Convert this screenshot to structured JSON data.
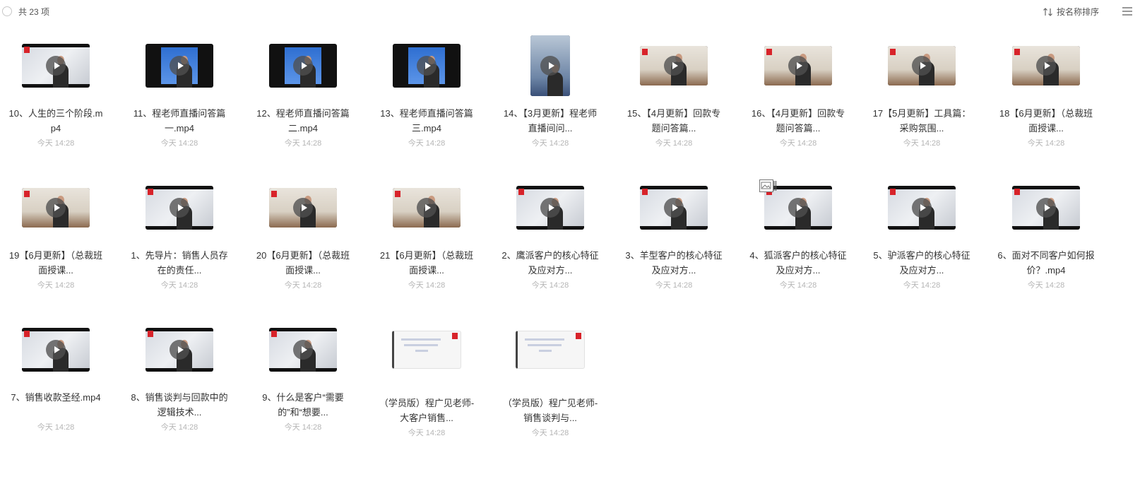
{
  "toolbar": {
    "count_label": "共 23 项",
    "sort_label": "按名称排序",
    "icons": [
      "sort-icon",
      "list-view-icon"
    ]
  },
  "files": [
    {
      "name": "10、人生的三个阶段.mp4",
      "time": "今天 14:28",
      "type": "video"
    },
    {
      "name": "11、程老师直播问答篇一.mp4",
      "time": "今天 14:28",
      "type": "video"
    },
    {
      "name": "12、程老师直播问答篇二.mp4",
      "time": "今天 14:28",
      "type": "video"
    },
    {
      "name": "13、程老师直播问答篇三.mp4",
      "time": "今天 14:28",
      "type": "video"
    },
    {
      "name": "14、【3月更新】程老师直播间问...",
      "time": "今天 14:28",
      "type": "video"
    },
    {
      "name": "15、【4月更新】回款专题问答篇...",
      "time": "今天 14:28",
      "type": "video"
    },
    {
      "name": "16、【4月更新】回款专题问答篇...",
      "time": "今天 14:28",
      "type": "video"
    },
    {
      "name": "17【5月更新】工具篇：采购氛围...",
      "time": "今天 14:28",
      "type": "video"
    },
    {
      "name": "18【6月更新】（总裁班面授课...",
      "time": "今天 14:28",
      "type": "video"
    },
    {
      "name": "19【6月更新】（总裁班面授课...",
      "time": "今天 14:28",
      "type": "video"
    },
    {
      "name": "1、先导片：销售人员存在的责任...",
      "time": "今天 14:28",
      "type": "video"
    },
    {
      "name": "20【6月更新】（总裁班面授课...",
      "time": "今天 14:28",
      "type": "video"
    },
    {
      "name": "21【6月更新】（总裁班面授课...",
      "time": "今天 14:28",
      "type": "video"
    },
    {
      "name": "2、鹰派客户的核心特征及应对方...",
      "time": "今天 14:28",
      "type": "video"
    },
    {
      "name": "3、羊型客户的核心特征及应对方...",
      "time": "今天 14:28",
      "type": "video"
    },
    {
      "name": "4、狐派客户的核心特征及应对方...",
      "time": "今天 14:28",
      "type": "video"
    },
    {
      "name": "5、驴派客户的核心特征及应对方...",
      "time": "今天 14:28",
      "type": "video"
    },
    {
      "name": "6、面对不同客户如何报价？.mp4",
      "time": "今天 14:28",
      "type": "video"
    },
    {
      "name": "7、销售收款圣经.mp4",
      "time": "今天 14:28",
      "type": "video"
    },
    {
      "name": "8、销售谈判与回款中的逻辑技术...",
      "time": "今天 14:28",
      "type": "video"
    },
    {
      "name": "9、什么是客户“需要的”和“想要...",
      "time": "今天 14:28",
      "type": "video"
    },
    {
      "name": "（学员版）程广见老师-大客户销售...",
      "time": "今天 14:28",
      "type": "document"
    },
    {
      "name": "（学员版）程广见老师-销售谈判与...",
      "time": "今天 14:28",
      "type": "document"
    }
  ]
}
